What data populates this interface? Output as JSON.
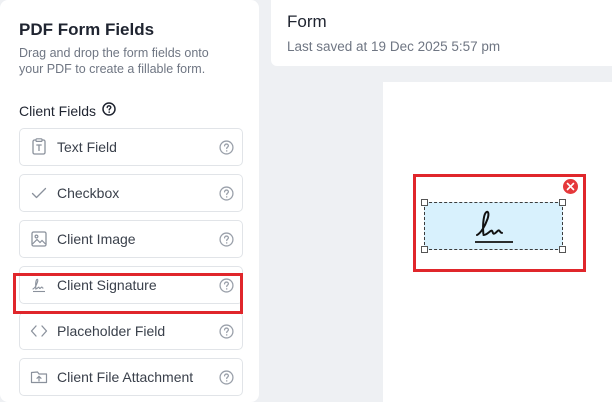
{
  "sidebar": {
    "title": "PDF Form Fields",
    "description": "Drag and drop the form fields onto your PDF to create a fillable form.",
    "section_heading": "Client Fields",
    "items": [
      {
        "label": "Text Field",
        "icon": "text-field-icon"
      },
      {
        "label": "Checkbox",
        "icon": "checkmark-icon"
      },
      {
        "label": "Client Image",
        "icon": "image-icon"
      },
      {
        "label": "Client Signature",
        "icon": "signature-icon"
      },
      {
        "label": "Placeholder Field",
        "icon": "code-brackets-icon"
      },
      {
        "label": "Client File Attachment",
        "icon": "folder-upload-icon"
      }
    ]
  },
  "header": {
    "title": "Form",
    "subtitle": "Last saved at 19 Dec 2025 5:57 pm"
  },
  "colors": {
    "highlight": "#e0262b",
    "signature_field_fill": "#d8f1fd",
    "remove_button": "#e5383b"
  }
}
